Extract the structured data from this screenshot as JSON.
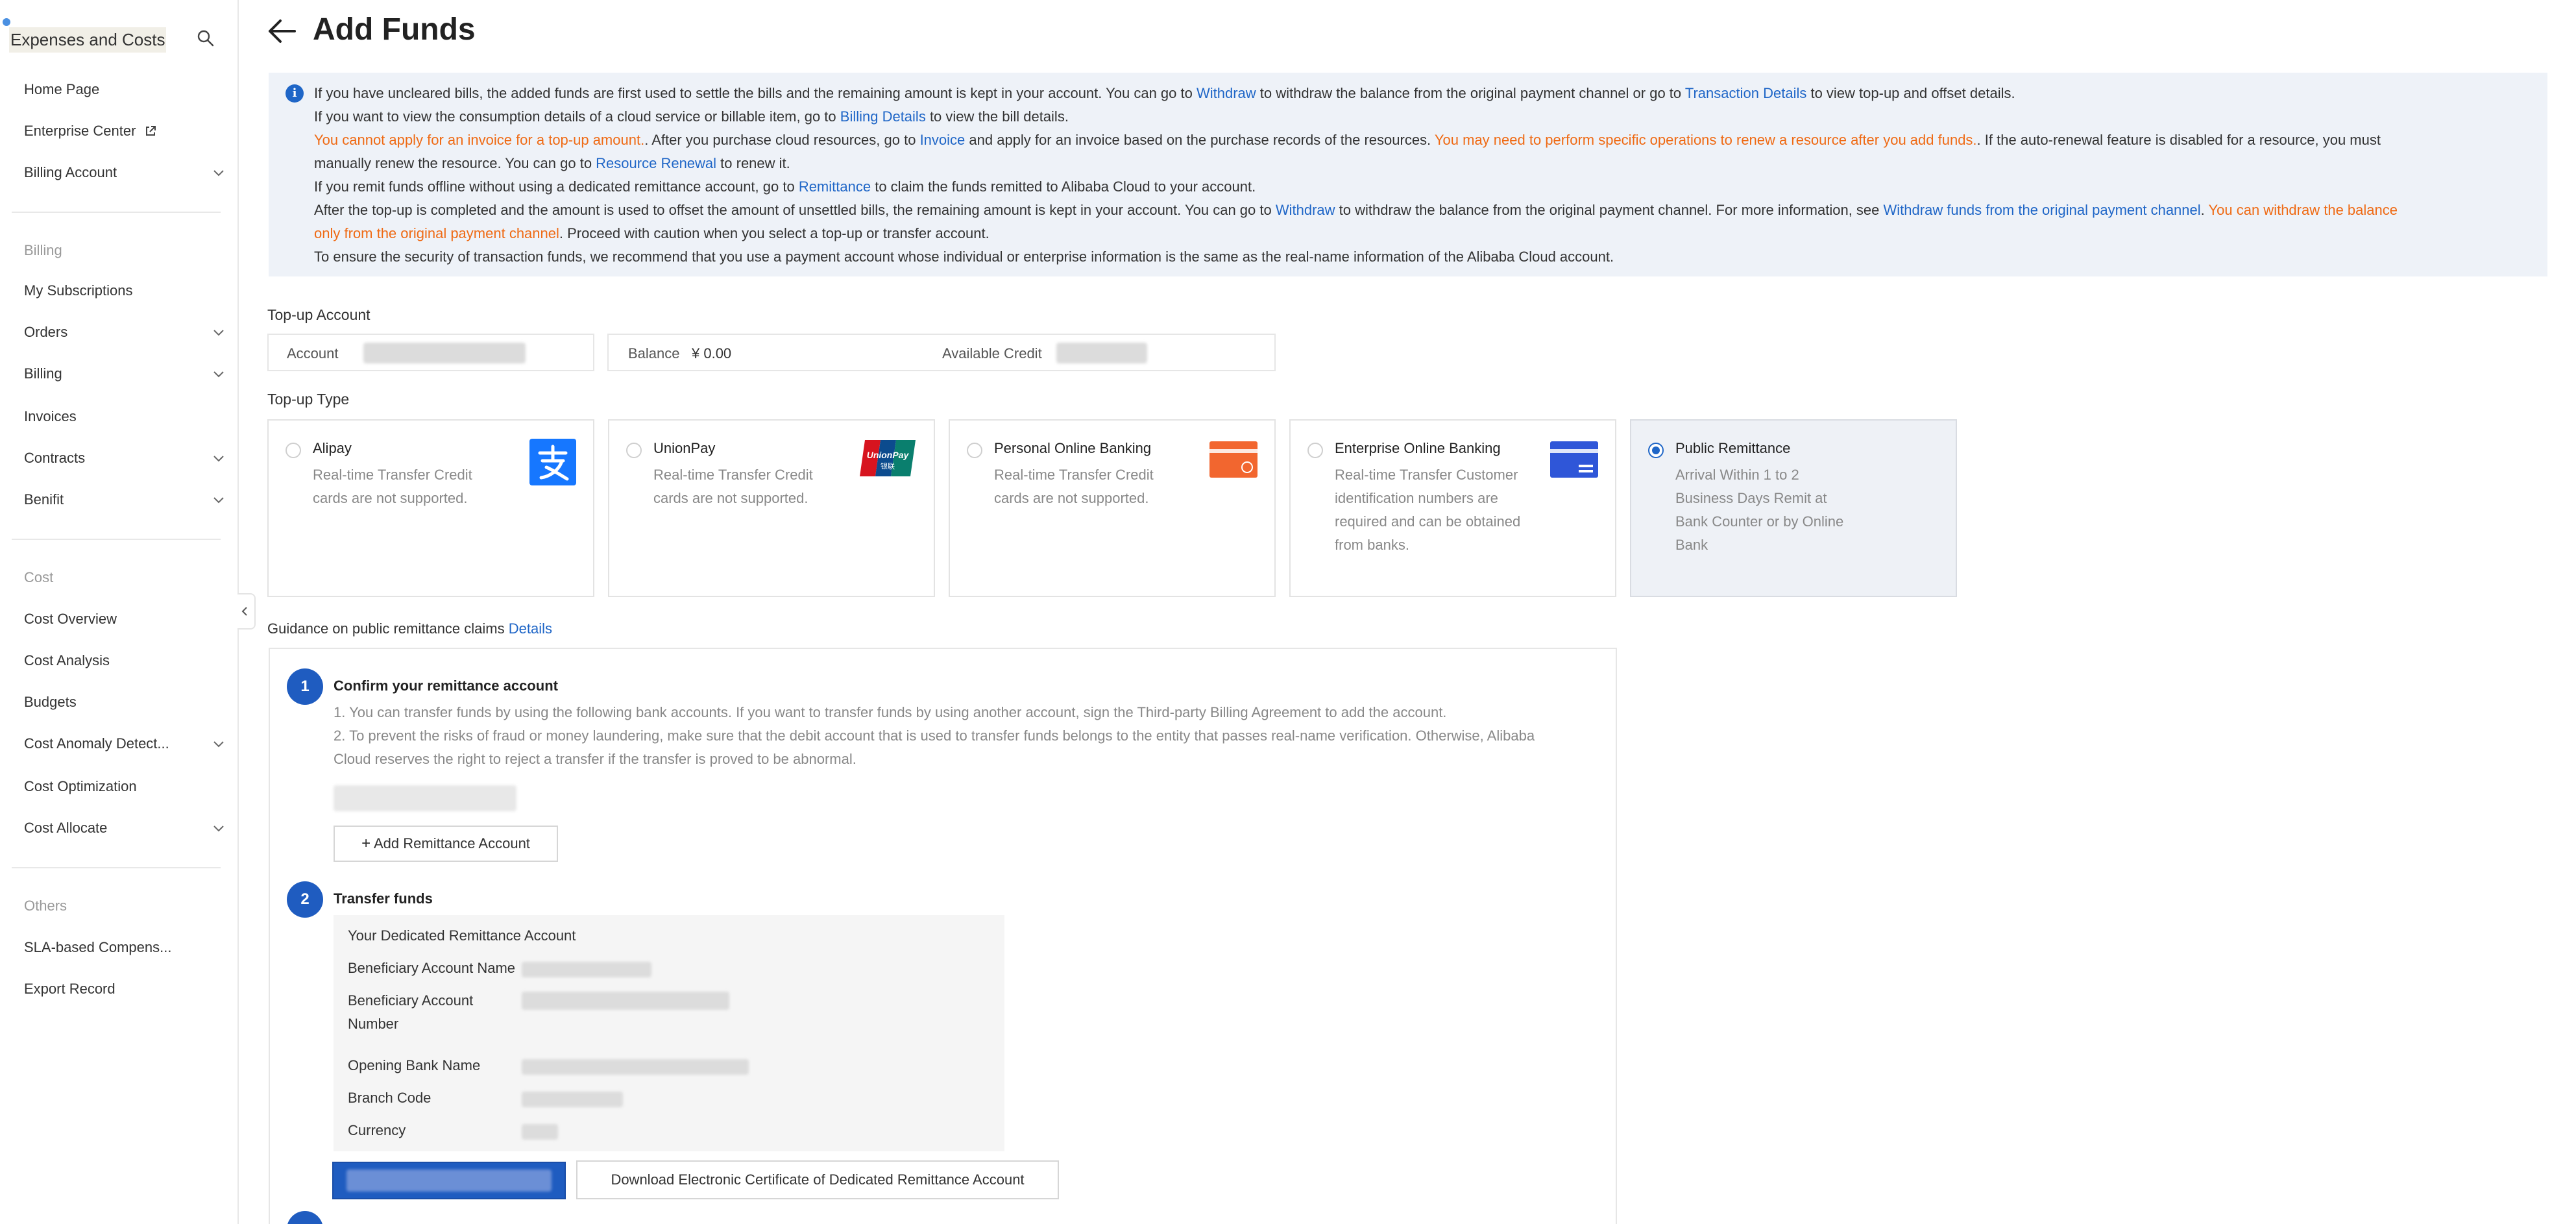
{
  "sidebar": {
    "title": "Expenses and Costs",
    "items": [
      {
        "label": "Home Page"
      },
      {
        "label": "Enterprise Center"
      },
      {
        "label": "Billing Account"
      }
    ],
    "groups": {
      "billing": "Billing",
      "cost": "Cost",
      "others": "Others"
    },
    "billing_items": [
      {
        "label": "My Subscriptions"
      },
      {
        "label": "Orders"
      },
      {
        "label": "Billing"
      },
      {
        "label": "Invoices"
      },
      {
        "label": "Contracts"
      },
      {
        "label": "Benifit"
      }
    ],
    "cost_items": [
      {
        "label": "Cost Overview"
      },
      {
        "label": "Cost Analysis"
      },
      {
        "label": "Budgets"
      },
      {
        "label": "Cost Anomaly Detect..."
      },
      {
        "label": "Cost Optimization"
      },
      {
        "label": "Cost Allocate"
      }
    ],
    "others_items": [
      {
        "label": "SLA-based Compens..."
      },
      {
        "label": "Export Record"
      }
    ]
  },
  "header": {
    "title": "Add Funds"
  },
  "notice": {
    "l1a": "If you have uncleared bills, the added funds are first used to settle the bills and the remaining amount is kept in your account. You can go to ",
    "l1b": "Withdraw",
    "l1c": " to withdraw the balance from the original payment channel or go to ",
    "l1d": "Transaction Details",
    "l1e": " to view top-up and offset details.",
    "l2a": "If you want to view the consumption details of a cloud service or billable item, go to ",
    "l2b": "Billing Details",
    "l2c": " to view the bill details.",
    "l3a": "You cannot apply for an invoice for a top-up amount.",
    "l3b": ". After you purchase cloud resources, go to ",
    "l3c": "Invoice",
    "l3d": " and apply for an invoice based on the purchase records of the resources. ",
    "l3e": "You may need to perform specific operations to renew a resource after you add funds.",
    "l3f": ". If the auto-renewal feature is disabled for a resource, you must",
    "l4a": "manually renew the resource. You can go to ",
    "l4b": "Resource Renewal",
    "l4c": " to renew it.",
    "l5a": "If you remit funds offline without using a dedicated remittance account, go to ",
    "l5b": "Remittance",
    "l5c": " to claim the funds remitted to Alibaba Cloud to your account.",
    "l6a": "After the top-up is completed and the amount is used to offset the amount of unsettled bills, the remaining amount is kept in your account. You can go to ",
    "l6b": "Withdraw",
    "l6c": " to withdraw the balance from the original payment channel. For more information, see ",
    "l6d": "Withdraw funds from the original payment channel",
    "l6e": ". ",
    "l6f": "You can withdraw the balance",
    "l7a": "only from the original payment channel",
    "l7b": ". Proceed with caution when you select a top-up or transfer account.",
    "l8": "To ensure the security of transaction funds, we recommend that you use a payment account whose individual or enterprise information is the same as the real-name information of the Alibaba Cloud account."
  },
  "topup_account": {
    "label": "Top-up Account",
    "account_label": "Account",
    "balance_label": "Balance",
    "balance_value": "¥ 0.00",
    "available_credit_label": "Available Credit"
  },
  "topup_type": {
    "label": "Top-up Type",
    "options": [
      {
        "title": "Alipay",
        "desc": "Real-time Transfer Credit cards are not supported.",
        "icon": "alipay-icon"
      },
      {
        "title": "UnionPay",
        "desc": "Real-time Transfer Credit cards are not supported.",
        "icon": "unionpay-icon"
      },
      {
        "title": "Personal Online Banking",
        "desc": "Real-time Transfer Credit cards are not supported.",
        "icon": "personal-bank-icon"
      },
      {
        "title": "Enterprise Online Banking",
        "desc": "Real-time Transfer Customer identification numbers are required and can be obtained from banks.",
        "icon": "enterprise-bank-icon"
      },
      {
        "title": "Public Remittance",
        "desc": "Arrival Within 1 to 2 Business Days Remit at Bank Counter or by Online Bank",
        "icon": "",
        "selected": true
      }
    ]
  },
  "guidance": {
    "text": "Guidance on public remittance claims",
    "link": "Details"
  },
  "steps": {
    "s1": {
      "num": "1",
      "title": "Confirm your remittance account",
      "t1": "1. You can transfer funds by using the following bank accounts. If you want to transfer funds by using another account, sign the Third-party Billing Agreement to add the account.",
      "t2a": "2. To prevent the risks of fraud or money laundering, make sure that the debit account that is used to transfer funds belongs to the entity that passes real-name verification. Otherwise, Alibaba",
      "t2b": "Cloud reserves the right to reject a transfer if the transfer is proved to be abnormal.",
      "add_button": "Add Remittance Account"
    },
    "s2": {
      "num": "2",
      "title": "Transfer funds",
      "panel_title": "Your Dedicated Remittance Account",
      "beneficiary_name": "Beneficiary Account Name",
      "beneficiary_number_1": "Beneficiary Account",
      "beneficiary_number_2": "Number",
      "opening_bank": "Opening Bank Name",
      "branch_code": "Branch Code",
      "currency": "Currency",
      "download_button": "Download Electronic Certificate of Dedicated Remittance Account"
    }
  },
  "colors": {
    "accent": "#1f66c7",
    "warning": "#ef6a14",
    "notice_bg": "#eef2f8"
  }
}
